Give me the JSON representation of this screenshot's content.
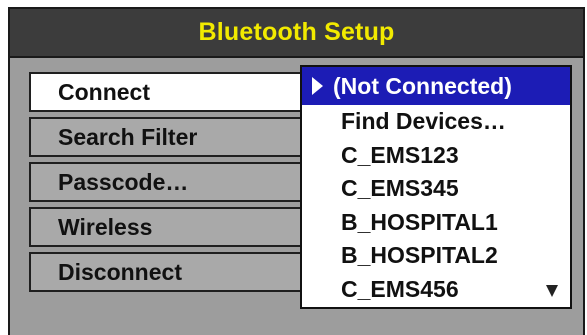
{
  "window": {
    "title": "Bluetooth Setup"
  },
  "colors": {
    "title_bg": "#3c3c3c",
    "title_text": "#f2ea00",
    "panel_bg": "#9d9d9d",
    "selected_highlight": "#1c1cb5"
  },
  "menu": {
    "items": [
      {
        "label": "Connect",
        "selected": true
      },
      {
        "label": "Search Filter",
        "selected": false
      },
      {
        "label": "Passcode…",
        "selected": false
      },
      {
        "label": "Wireless",
        "selected": false
      },
      {
        "label": "Disconnect",
        "selected": false
      }
    ]
  },
  "dropdown": {
    "selected_label": "(Not Connected)",
    "selected_icon": "triangle-right-icon",
    "items": [
      "Find Devices…",
      "C_EMS123",
      "C_EMS345",
      "B_HOSPITAL1",
      "B_HOSPITAL2",
      "C_EMS456"
    ],
    "scroll_icon": "triangle-down-icon"
  }
}
